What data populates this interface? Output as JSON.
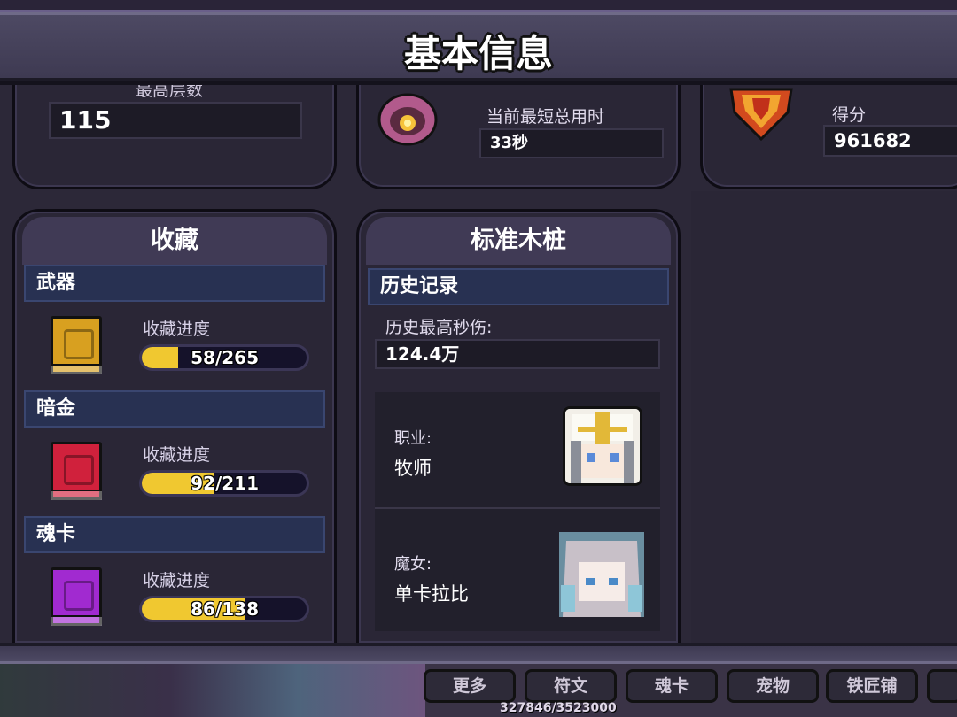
{
  "header": {
    "title": "基本信息"
  },
  "top_panels": {
    "floors": {
      "label": "最高层数",
      "value": "115"
    },
    "time": {
      "label": "当前最短总用时",
      "value": "33秒"
    },
    "score": {
      "label": "得分",
      "value": "961682"
    }
  },
  "collection": {
    "title": "收藏",
    "progress_label": "收藏进度",
    "categories": [
      {
        "name": "武器",
        "progress": "58/265",
        "fraction": 0.219,
        "icon": "gold-book-icon"
      },
      {
        "name": "暗金",
        "progress": "92/211",
        "fraction": 0.436,
        "icon": "red-book-icon"
      },
      {
        "name": "魂卡",
        "progress": "86/138",
        "fraction": 0.623,
        "icon": "purple-book-icon"
      }
    ]
  },
  "stake": {
    "title": "标准木桩",
    "history_label": "历史记录",
    "max_dps_label": "历史最高秒伤:",
    "max_dps_value": "124.4万",
    "class_label": "职业:",
    "class_value": "牧师",
    "witch_label": "魔女:",
    "witch_value": "单卡拉比"
  },
  "bottom_nav": {
    "buttons": [
      "更多",
      "符文",
      "魂卡",
      "宠物",
      "铁匠铺"
    ],
    "exp": "327846/3523000"
  },
  "colors": {
    "progress_fill": "#f0c830",
    "category_bar": "#283152",
    "header": "#4d4963"
  }
}
